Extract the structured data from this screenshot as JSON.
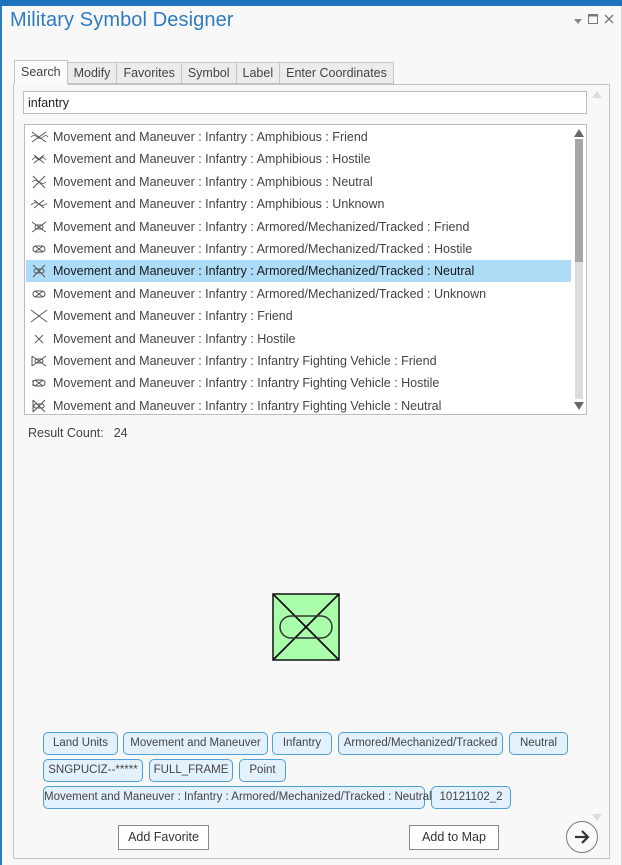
{
  "window": {
    "title": "Military Symbol Designer",
    "controls": {
      "menu_icon": "dropdown-arrow-icon",
      "maximize_icon": "maximize-icon",
      "close_icon": "close-icon"
    },
    "accent_color": "#1e73be"
  },
  "tabs": [
    {
      "label": "Search",
      "active": true
    },
    {
      "label": "Modify",
      "active": false
    },
    {
      "label": "Favorites",
      "active": false
    },
    {
      "label": "Symbol",
      "active": false
    },
    {
      "label": "Label",
      "active": false
    },
    {
      "label": "Enter Coordinates",
      "active": false
    }
  ],
  "search": {
    "value": "infantry",
    "placeholder": ""
  },
  "results": {
    "selected_index": 6,
    "selection_color": "#aedcf7",
    "items": [
      {
        "label": "Movement and Maneuver : Infantry : Amphibious : Friend",
        "icon": "infantry-amphibious-friend-icon"
      },
      {
        "label": "Movement and Maneuver : Infantry : Amphibious : Hostile",
        "icon": "infantry-amphibious-hostile-icon"
      },
      {
        "label": "Movement and Maneuver : Infantry : Amphibious : Neutral",
        "icon": "infantry-amphibious-neutral-icon"
      },
      {
        "label": "Movement and Maneuver : Infantry : Amphibious : Unknown",
        "icon": "infantry-amphibious-unknown-icon"
      },
      {
        "label": "Movement and Maneuver : Infantry : Armored/Mechanized/Tracked : Friend",
        "icon": "infantry-armored-friend-icon"
      },
      {
        "label": "Movement and Maneuver : Infantry : Armored/Mechanized/Tracked : Hostile",
        "icon": "infantry-armored-hostile-icon"
      },
      {
        "label": "Movement and Maneuver : Infantry : Armored/Mechanized/Tracked : Neutral",
        "icon": "infantry-armored-neutral-icon"
      },
      {
        "label": "Movement and Maneuver : Infantry : Armored/Mechanized/Tracked : Unknown",
        "icon": "infantry-armored-unknown-icon"
      },
      {
        "label": "Movement and Maneuver : Infantry : Friend",
        "icon": "infantry-friend-icon"
      },
      {
        "label": "Movement and Maneuver : Infantry : Hostile",
        "icon": "infantry-hostile-icon"
      },
      {
        "label": "Movement and Maneuver : Infantry : Infantry Fighting Vehicle : Friend",
        "icon": "infantry-ifv-friend-icon"
      },
      {
        "label": "Movement and Maneuver : Infantry : Infantry Fighting Vehicle : Hostile",
        "icon": "infantry-ifv-hostile-icon"
      },
      {
        "label": "Movement and Maneuver : Infantry : Infantry Fighting Vehicle : Neutral",
        "icon": "infantry-ifv-neutral-icon"
      }
    ],
    "scroll_position": 0
  },
  "result_count": {
    "label": "Result Count:",
    "value": "24"
  },
  "preview": {
    "symbol": "infantry-armored-neutral-symbol",
    "fill_color": "#aaffaa"
  },
  "tags": [
    "Land Units",
    "Movement and Maneuver",
    "Infantry",
    "Armored/Mechanized/Tracked",
    "Neutral",
    "SNGPUCIZ--*****",
    "FULL_FRAME",
    "Point",
    "Movement and Maneuver : Infantry : Armored/Mechanized/Tracked : Neutral",
    "10121102_2"
  ],
  "tag_color": "#4e9fd8",
  "buttons": {
    "add_favorite": "Add Favorite",
    "add_to_map": "Add to Map",
    "next_icon": "arrow-right-circle-icon"
  }
}
